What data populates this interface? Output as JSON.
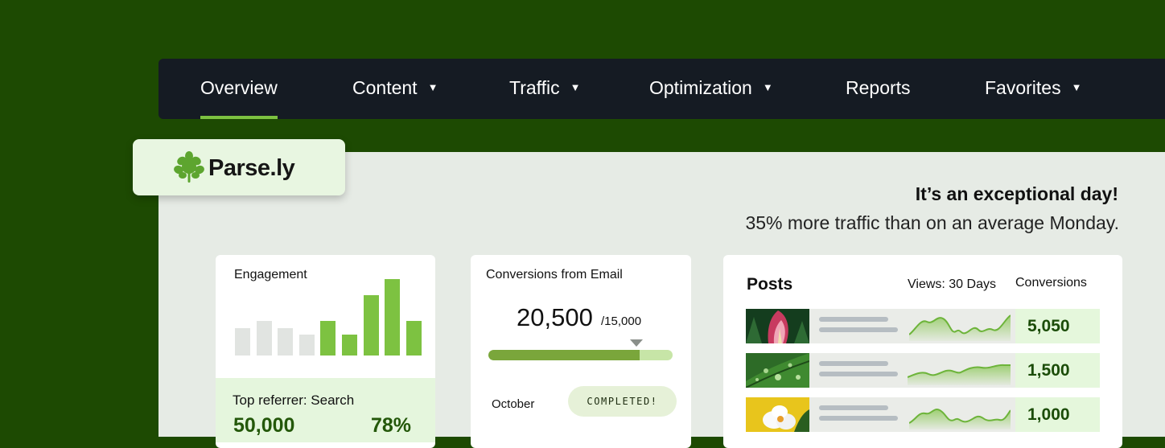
{
  "nav": {
    "items": [
      {
        "label": "Overview",
        "dropdown": false,
        "active": true
      },
      {
        "label": "Content",
        "dropdown": true
      },
      {
        "label": "Traffic",
        "dropdown": true
      },
      {
        "label": "Optimization",
        "dropdown": true
      },
      {
        "label": "Reports",
        "dropdown": false
      },
      {
        "label": "Favorites",
        "dropdown": true
      }
    ],
    "caret": "▼"
  },
  "brand": {
    "name": "Parse.ly",
    "icon": "parsley-leaf-icon",
    "color": "#5da52f"
  },
  "banner": {
    "headline": "It’s an exceptional day!",
    "subline": "35% more traffic than on an average Monday."
  },
  "engagement": {
    "title": "Engagement",
    "bars": [
      {
        "value": 36,
        "highlight": false
      },
      {
        "value": 45,
        "highlight": false
      },
      {
        "value": 36,
        "highlight": false
      },
      {
        "value": 27,
        "highlight": false
      },
      {
        "value": 45,
        "highlight": true
      },
      {
        "value": 27,
        "highlight": true
      },
      {
        "value": 79,
        "highlight": true
      },
      {
        "value": 100,
        "highlight": true
      },
      {
        "value": 45,
        "highlight": true
      }
    ],
    "referrer_label": "Top referrer: Search",
    "referrer_value": "50,000",
    "referrer_percent": "78%"
  },
  "conversions": {
    "title": "Conversions from Email",
    "value": "20,500",
    "goal": "/15,000",
    "progress": 0.82,
    "month": "October",
    "status": "COMPLETED!"
  },
  "posts": {
    "title": "Posts",
    "views_header": "Views: 30 Days",
    "conversions_header": "Conversions",
    "rows": [
      {
        "thumb": "tulip-photo",
        "conversions": "5,050"
      },
      {
        "thumb": "leaf-droplets-photo",
        "conversions": "1,500"
      },
      {
        "thumb": "white-flower-photo",
        "conversions": "1,000"
      }
    ]
  },
  "colors": {
    "background": "#1d4a02",
    "navbar": "#151b23",
    "accent": "#7dc241",
    "panel": "#e6ebe5",
    "bar_gray": "#e1e4e1",
    "bar_green": "#7dc241"
  }
}
